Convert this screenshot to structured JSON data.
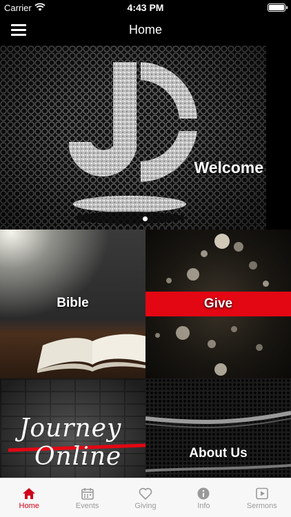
{
  "status_bar": {
    "carrier": "Carrier",
    "time": "4:43 PM"
  },
  "nav": {
    "title": "Home"
  },
  "hero": {
    "caption": "Welcome",
    "page_count": 1,
    "current_page": 1
  },
  "tiles": [
    {
      "label": "Bible"
    },
    {
      "label": "Give"
    },
    {
      "label": "Journey Online"
    },
    {
      "label": "About Us"
    }
  ],
  "journey_script": [
    "Journey",
    "Online"
  ],
  "tabs": [
    {
      "label": "Home",
      "icon": "home-icon",
      "active": true
    },
    {
      "label": "Events",
      "icon": "calendar-icon",
      "active": false
    },
    {
      "label": "Giving",
      "icon": "heart-icon",
      "active": false
    },
    {
      "label": "Info",
      "icon": "info-icon",
      "active": false
    },
    {
      "label": "Sermons",
      "icon": "play-icon",
      "active": false
    }
  ],
  "colors": {
    "accent": "#d0021b",
    "band": "#e30613",
    "tab_inactive": "#9a9a9a"
  }
}
